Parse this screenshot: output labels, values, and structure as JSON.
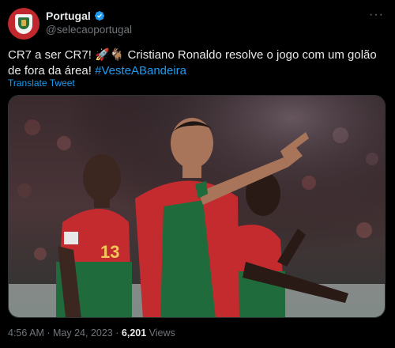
{
  "account": {
    "display_name": "Portugal",
    "handle": "@selecaoportugal",
    "verified_icon": "verified-badge-icon",
    "accent": "#1d9bf0"
  },
  "tweet": {
    "text_plain": "CR7 a ser CR7! 🚀🐐 Cristiano Ronaldo resolve o jogo com um golão de fora da área!",
    "hashtag": "#VesteABandeira",
    "translate_label": "Translate Tweet"
  },
  "media": {
    "jersey_number": "13"
  },
  "meta": {
    "time": "4:56 AM",
    "separator": "·",
    "date": "May 24, 2023",
    "views_count": "6,201",
    "views_label": "Views"
  },
  "more_icon": "more-icon"
}
